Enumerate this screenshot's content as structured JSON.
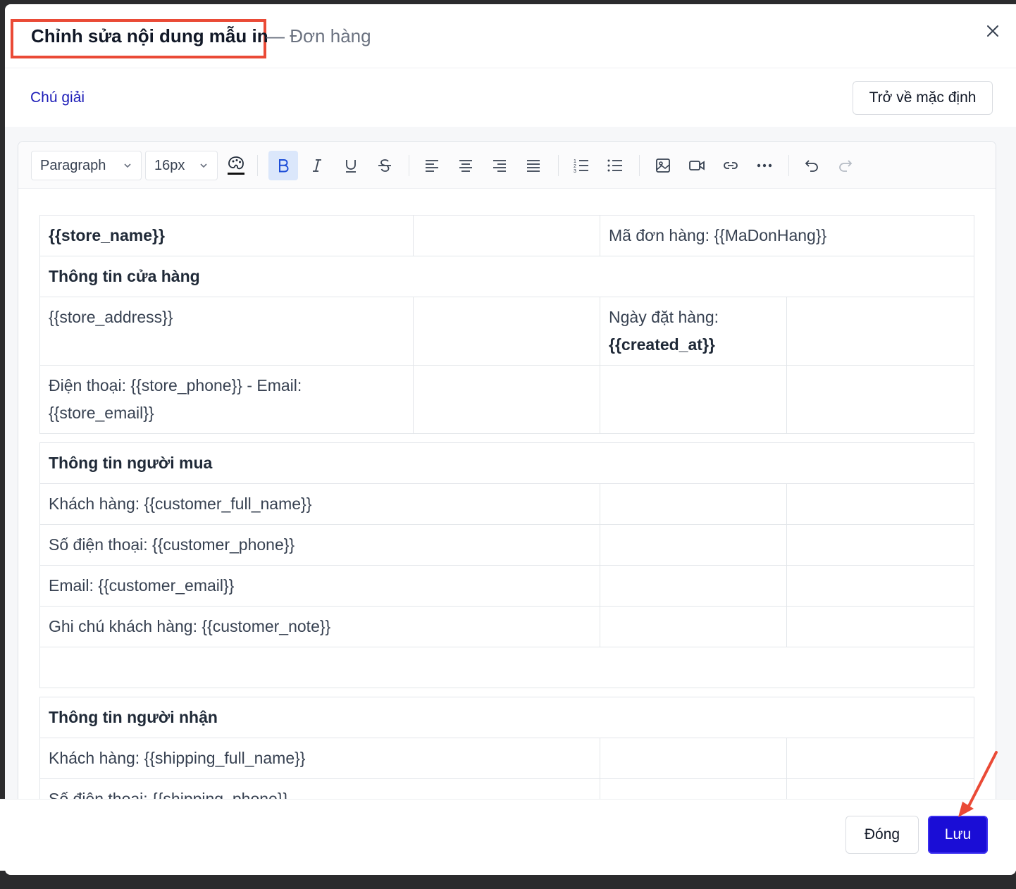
{
  "modal": {
    "title": "Chỉnh sửa nội dung mẫu in",
    "subtitle": "— Đơn hàng",
    "legend_link": "Chú giải",
    "reset_button": "Trở về mặc định"
  },
  "toolbar": {
    "block_format": "Paragraph",
    "font_size": "16px"
  },
  "document": {
    "store_name": "{{store_name}}",
    "order_code": "Mã đơn hàng: {{MaDonHang}}",
    "store_info_heading": "Thông tin cửa hàng",
    "store_address": "{{store_address}}",
    "order_date_label": "Ngày đặt hàng:",
    "order_date_value": "{{created_at}}",
    "store_contact": "Điện thoại: {{store_phone}} - Email: {{store_email}}",
    "buyer_heading": "Thông tin người mua",
    "buyer_name": "Khách hàng: {{customer_full_name}}",
    "buyer_phone": "Số điện thoại: {{customer_phone}}",
    "buyer_email": "Email: {{customer_email}}",
    "buyer_note": "Ghi chú khách hàng: {{customer_note}}",
    "recipient_heading": "Thông tin người nhận",
    "recipient_name": "Khách hàng: {{shipping_full_name}}",
    "recipient_phone": "Số điện thoại: {{shipping_phone}}"
  },
  "footer": {
    "close_button": "Đóng",
    "save_button": "Lưu"
  },
  "colors": {
    "primary": "#1a0dd6",
    "highlight": "#ea4a36",
    "link": "#1d1db8"
  }
}
